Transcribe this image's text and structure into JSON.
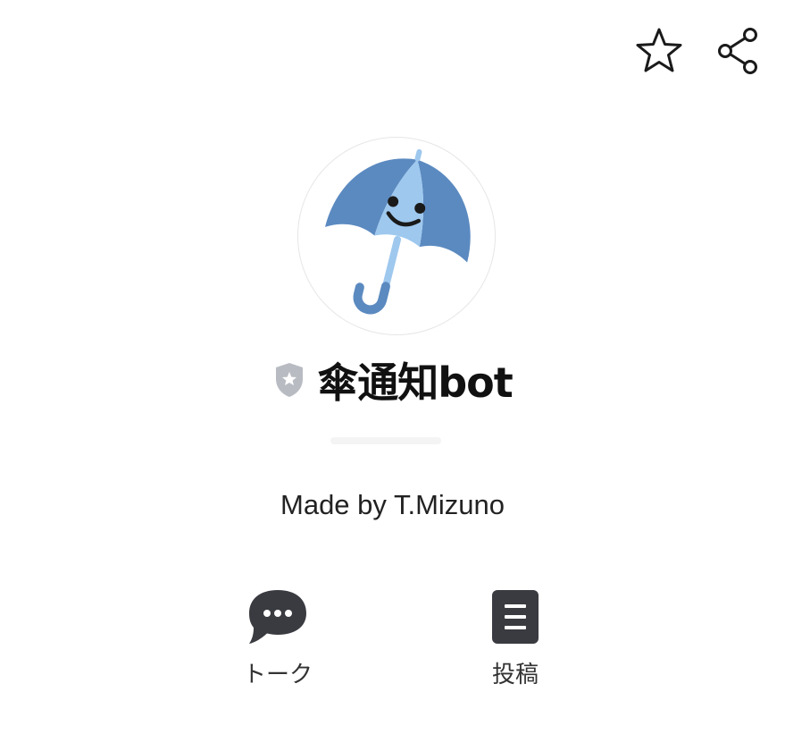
{
  "header": {
    "favorite_icon": "star-outline-icon",
    "share_icon": "share-icon"
  },
  "profile": {
    "avatar_icon": "umbrella-face-icon",
    "badge_icon": "shield-star-icon",
    "name": "傘通知bot",
    "status_message": "Made by T.Mizuno"
  },
  "actions": [
    {
      "label": "トーク",
      "icon": "chat-bubble-icon"
    },
    {
      "label": "投稿",
      "icon": "post-document-icon"
    }
  ],
  "colors": {
    "background": "#ffffff",
    "text": "#111111",
    "icon_dark": "#3a3b40",
    "umbrella_dark_blue": "#5b8ac0",
    "umbrella_light_blue": "#9ec8ee",
    "badge_gray": "#b8bcc2"
  }
}
